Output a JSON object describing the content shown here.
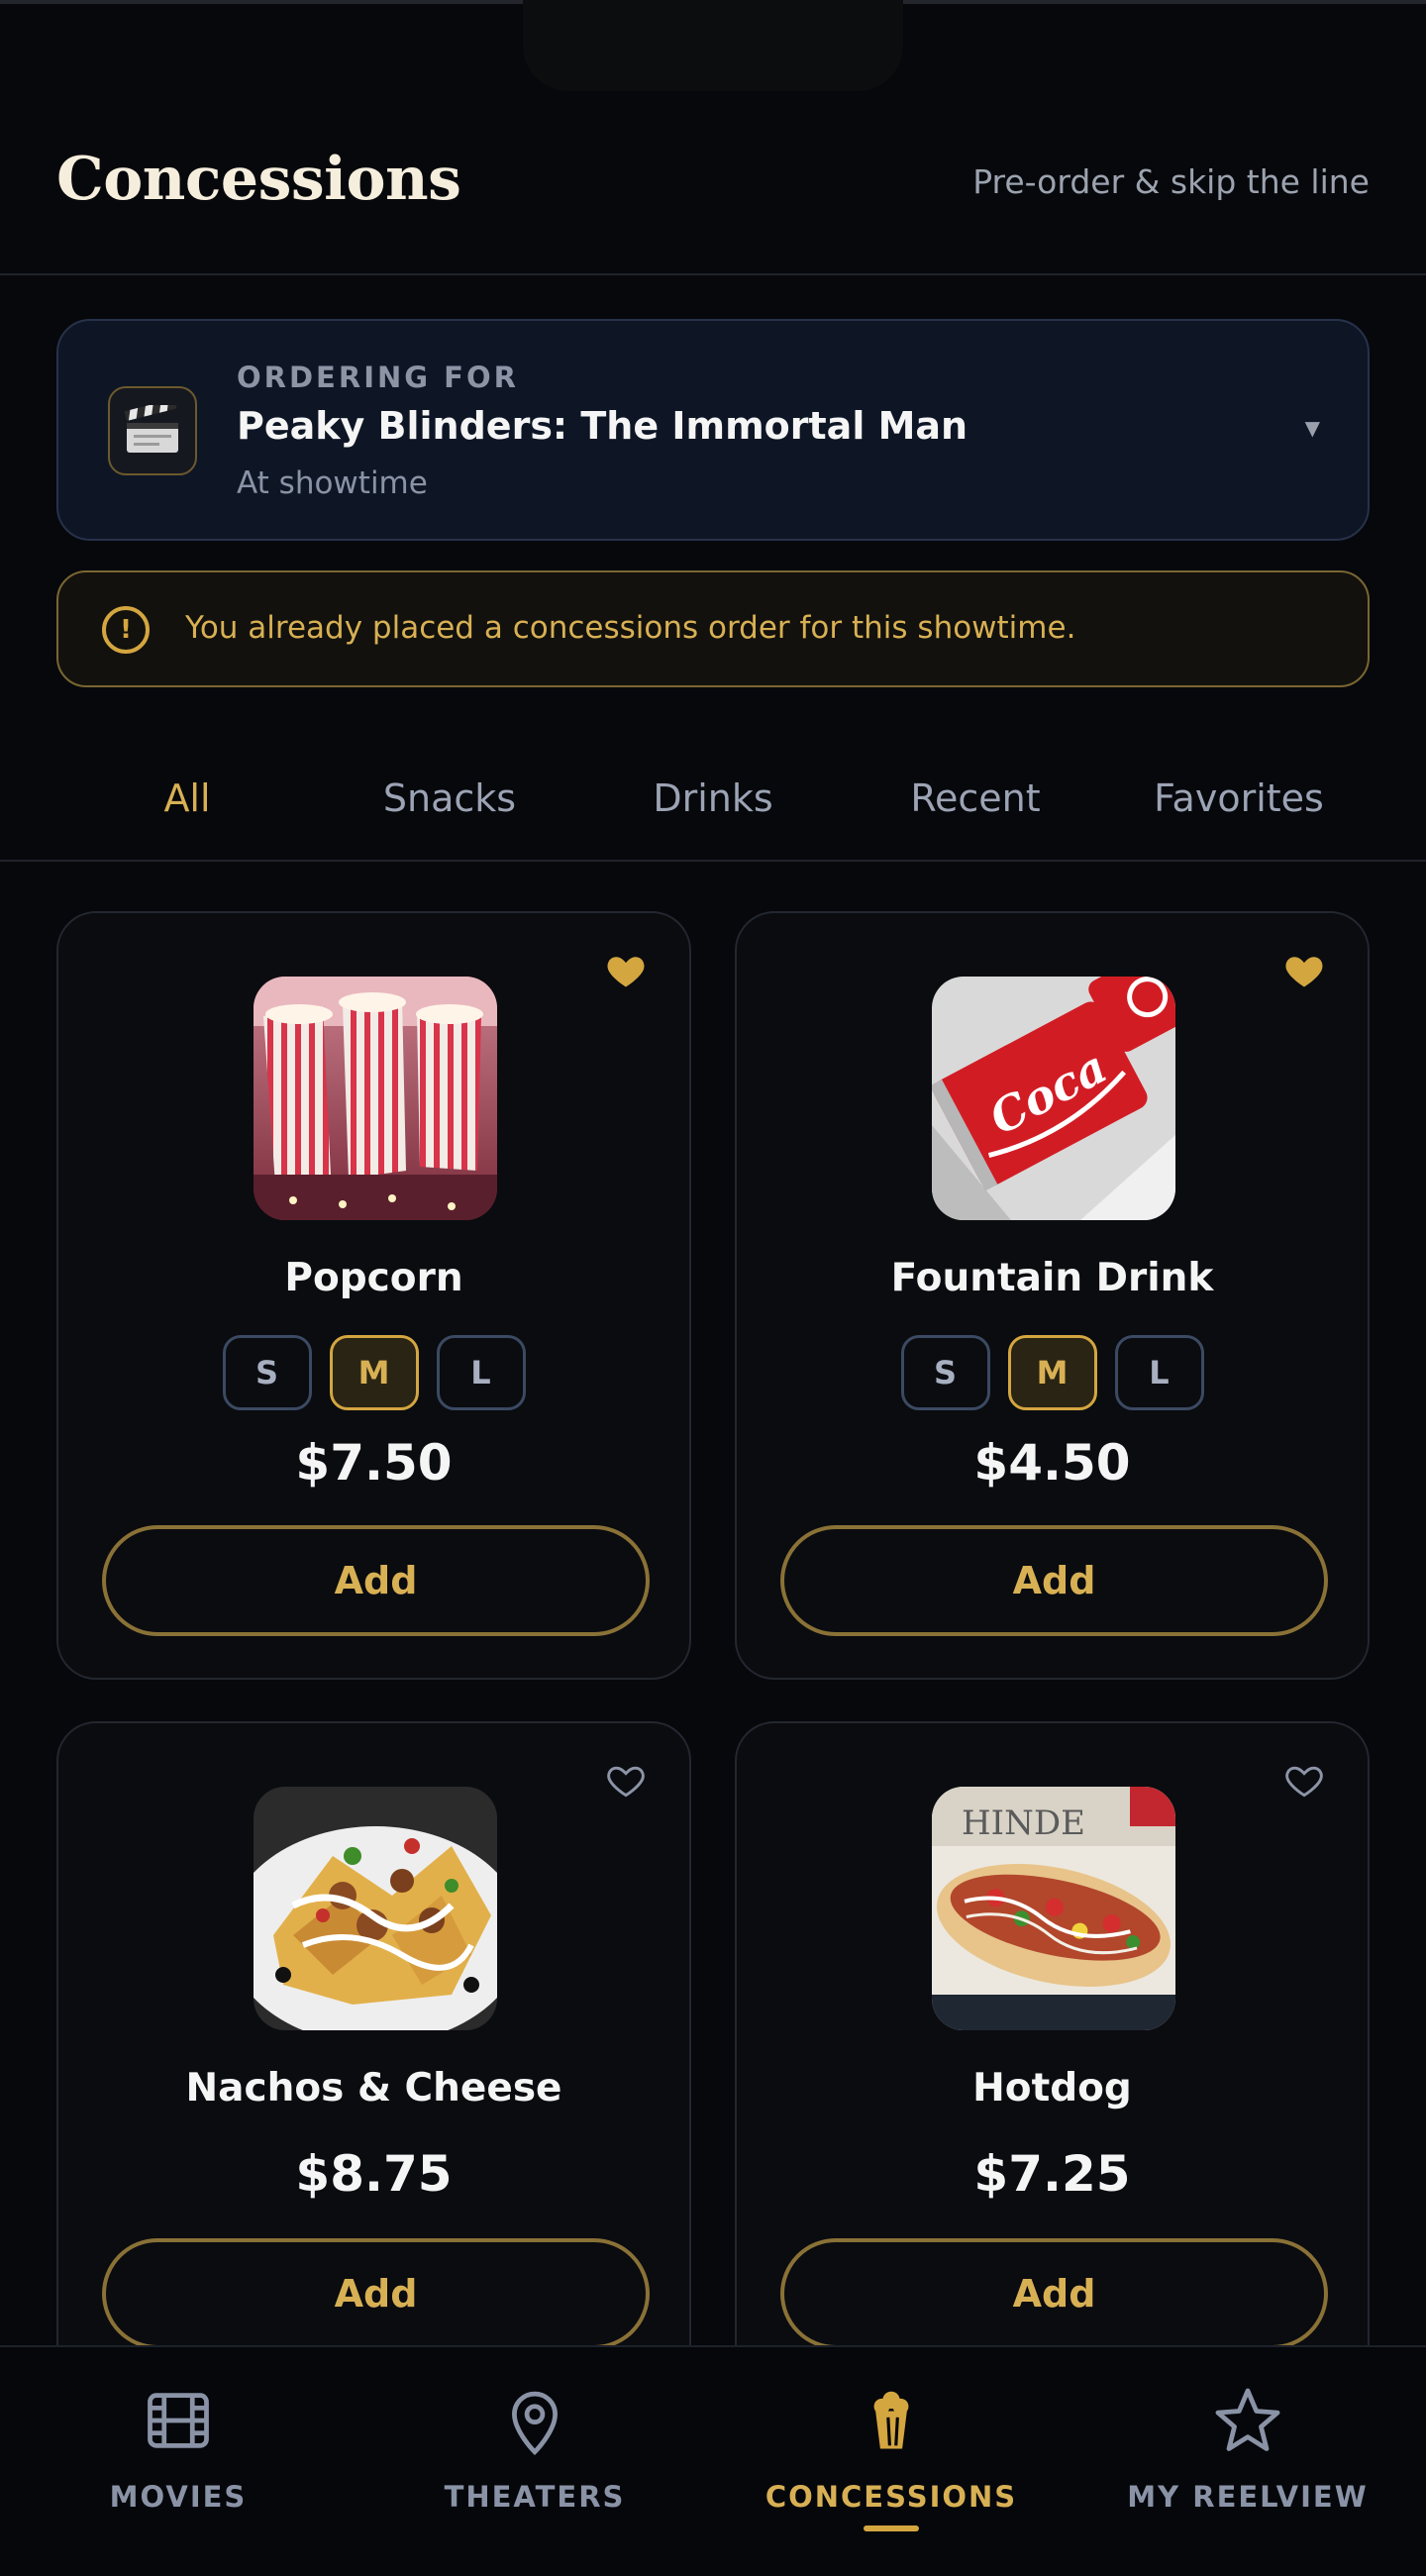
{
  "header": {
    "title": "Concessions",
    "subtitle": "Pre-order & skip the line"
  },
  "order_for": {
    "label": "ORDERING FOR",
    "movie": "Peaky Blinders: The Immortal Man",
    "time": "At showtime",
    "icon": "clapperboard-icon"
  },
  "warning": {
    "text": "You already placed a concessions order for this showtime.",
    "icon": "alert-circle-icon"
  },
  "tabs": [
    "All",
    "Snacks",
    "Drinks",
    "Recent",
    "Favorites"
  ],
  "active_tab": "All",
  "items": [
    {
      "name": "Popcorn",
      "price": "$7.50",
      "favorite": true,
      "sizes": [
        "S",
        "M",
        "L"
      ],
      "selected_size": "M",
      "add_label": "Add"
    },
    {
      "name": "Fountain Drink",
      "price": "$4.50",
      "favorite": true,
      "sizes": [
        "S",
        "M",
        "L"
      ],
      "selected_size": "M",
      "add_label": "Add"
    },
    {
      "name": "Nachos & Cheese",
      "price": "$8.75",
      "favorite": false,
      "add_label": "Add"
    },
    {
      "name": "Hotdog",
      "price": "$7.25",
      "favorite": false,
      "add_label": "Add"
    }
  ],
  "nav": {
    "items": [
      {
        "label": "MOVIES",
        "icon": "film-icon"
      },
      {
        "label": "THEATERS",
        "icon": "map-pin-icon"
      },
      {
        "label": "CONCESSIONS",
        "icon": "popcorn-icon"
      },
      {
        "label": "MY REELVIEW",
        "icon": "star-icon"
      }
    ],
    "active": "CONCESSIONS"
  },
  "colors": {
    "accent": "#d4a640",
    "background": "#06080c",
    "card": "#0a0c10"
  }
}
